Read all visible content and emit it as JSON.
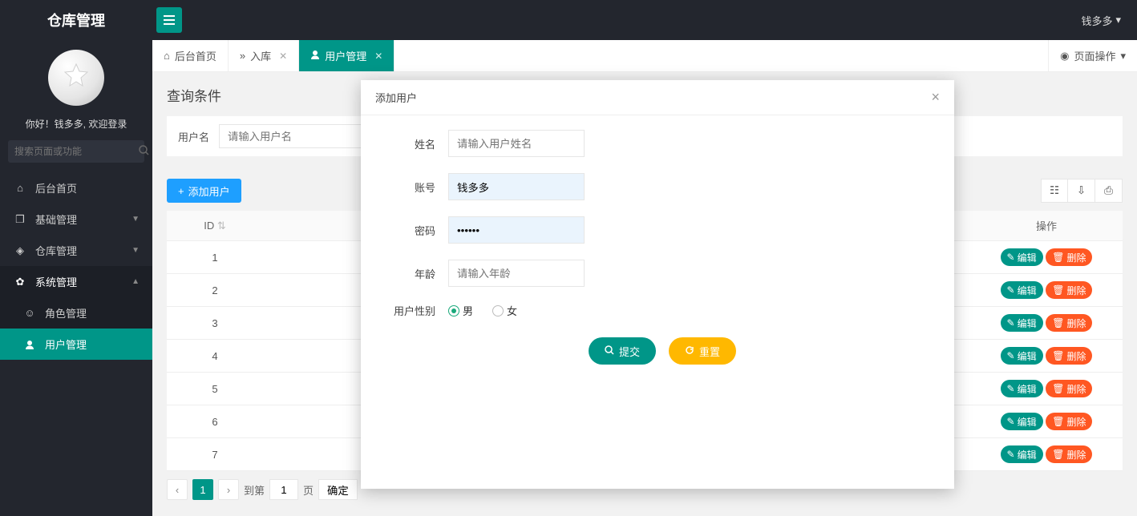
{
  "header": {
    "brand": "仓库管理",
    "user_name": "钱多多"
  },
  "sidebar": {
    "welcome": "你好！钱多多, 欢迎登录",
    "search_placeholder": "搜索页面或功能",
    "items": [
      {
        "label": "后台首页",
        "icon": "home"
      },
      {
        "label": "基础管理",
        "icon": "cube",
        "expandable": true
      },
      {
        "label": "仓库管理",
        "icon": "dice",
        "expandable": true
      },
      {
        "label": "系统管理",
        "icon": "gear",
        "expandable": true,
        "open": true
      },
      {
        "label": "角色管理",
        "icon": "smile",
        "sub": true
      },
      {
        "label": "用户管理",
        "icon": "user",
        "sub": true,
        "active": true
      }
    ]
  },
  "tabs": {
    "items": [
      {
        "label": "后台首页",
        "icon": "home"
      },
      {
        "label": "入库",
        "icon": "chevrons"
      },
      {
        "label": "用户管理",
        "icon": "user",
        "active": true
      }
    ],
    "ops_label": "页面操作"
  },
  "page": {
    "panel_title": "查询条件",
    "filter_user_label": "用户名",
    "filter_user_placeholder": "请输入用户名",
    "add_user_btn": "添加用户",
    "table": {
      "col_id": "ID",
      "col_op": "操作",
      "rows": [
        1,
        2,
        3,
        4,
        5,
        6,
        7
      ],
      "edit_label": "编辑",
      "del_label": "删除"
    },
    "pager": {
      "cur": "1",
      "to_label_a": "到第",
      "to_input": "1",
      "to_label_b": "页",
      "go": "确定"
    }
  },
  "modal": {
    "title": "添加用户",
    "fields": {
      "name_label": "姓名",
      "name_placeholder": "请输入用户姓名",
      "acct_label": "账号",
      "acct_value": "钱多多",
      "pwd_label": "密码",
      "pwd_value": "••••••",
      "age_label": "年龄",
      "age_placeholder": "请输入年龄",
      "gender_label": "用户性别",
      "gender_male": "男",
      "gender_female": "女"
    },
    "submit": "提交",
    "reset": "重置"
  }
}
